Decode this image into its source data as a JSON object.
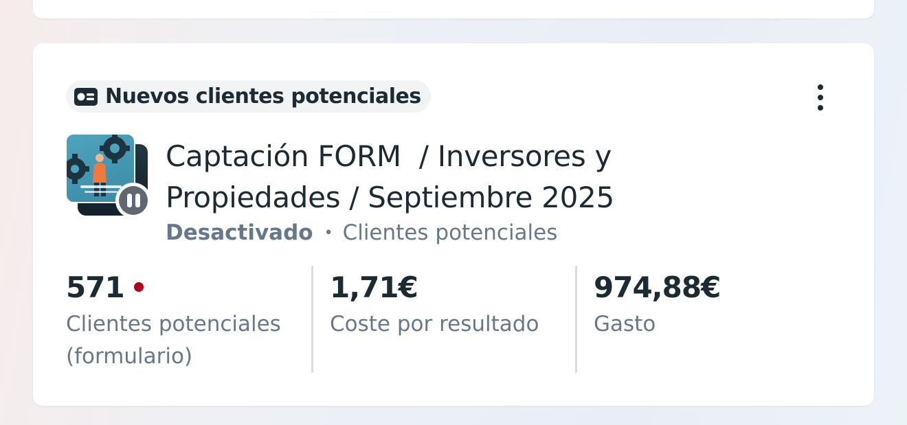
{
  "campaign": {
    "result_type_label": "Nuevos clientes potenciales",
    "result_type_icon": "lead-form-icon",
    "more_options_icon": "more-vertical-icon",
    "thumbnail_icon": "ad-creative-thumbnail",
    "status_icon": "pause-icon",
    "name": "Captación FORM  / Inversores y Propiedades / Septiembre 2025",
    "status": "Desactivado",
    "separator": "•",
    "objective": "Clientes potenciales"
  },
  "metrics": [
    {
      "value": "571",
      "label": "Clientes potenciales (formulario)",
      "alert": true
    },
    {
      "value": "1,71€",
      "label": "Coste por resultado"
    },
    {
      "value": "974,88€",
      "label": "Gasto"
    }
  ],
  "colors": {
    "text_primary": "#1c2b33",
    "text_secondary": "#67788a",
    "alert": "#b3001e",
    "chip_background": "#f1f3f5",
    "status_badge": "#606770"
  }
}
